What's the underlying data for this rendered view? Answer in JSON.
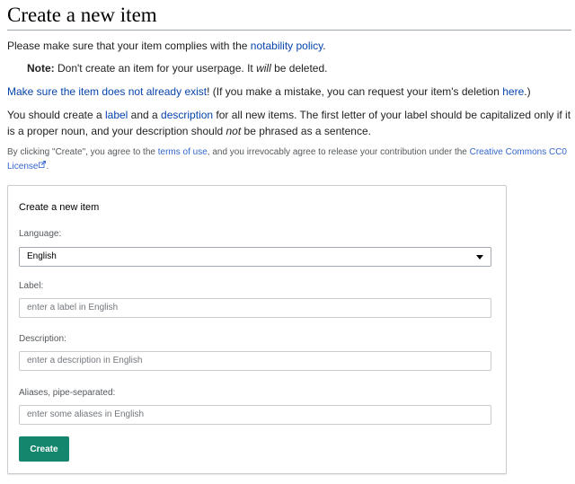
{
  "page": {
    "title": "Create a new item"
  },
  "intro": {
    "line1_text": "Please make sure that your item complies with the ",
    "line1_link": "notability policy",
    "line1_end": "."
  },
  "note": {
    "label": "Note:",
    "text1": " Don't create an item for your userpage. It ",
    "emph": "will",
    "text2": " be deleted."
  },
  "exist": {
    "link": "Make sure the item does not already exist",
    "text1": "! (If you make a mistake, you can request your item's deletion ",
    "link2": "here",
    "text2": ".)"
  },
  "guidance": {
    "t1": "You should create a ",
    "label_link": "label",
    "t2": " and a ",
    "description_link": "description",
    "t3": " for all new items. The first letter of your label should be capitalized only if it is a proper noun, and your description should ",
    "emph": "not",
    "t4": " be phrased as a sentence."
  },
  "license": {
    "t1": "By clicking \"Create\", you agree to the ",
    "terms_link": "terms of use",
    "t2": ", and you irrevocably agree to release your contribution under the ",
    "cc_link": "Creative Commons CC0 License",
    "t3": "."
  },
  "form": {
    "title": "Create a new item",
    "language_label": "Language:",
    "language_value": "English",
    "label_label": "Label:",
    "label_placeholder": "enter a label in English",
    "description_label": "Description:",
    "description_placeholder": "enter a description in English",
    "aliases_label": "Aliases, pipe-separated:",
    "aliases_placeholder": "enter some aliases in English",
    "submit_label": "Create"
  },
  "colors": {
    "link": "#0645ad",
    "button": "#14866d"
  }
}
